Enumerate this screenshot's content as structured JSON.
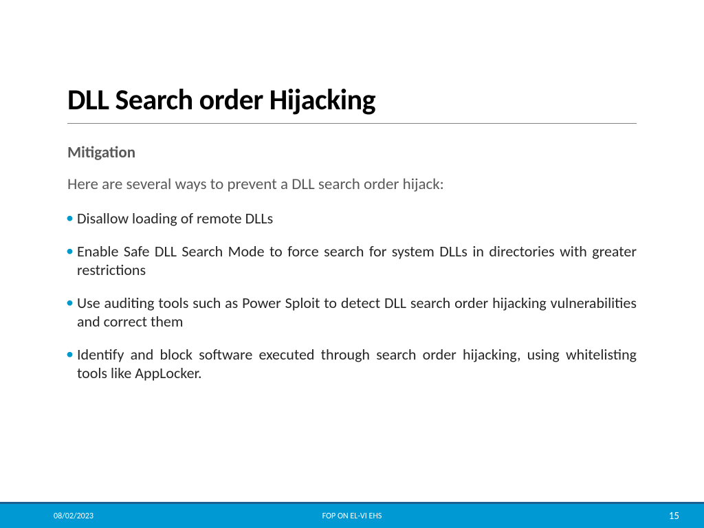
{
  "slide": {
    "title": "DLL Search order Hijacking",
    "section_heading": "Mitigation",
    "intro": "Here are several ways to prevent a DLL search order hijack:",
    "bullets": [
      "Disallow loading of remote DLLs",
      "Enable Safe DLL Search Mode to force search for system DLLs in directories with greater restrictions",
      "Use auditing tools such as Power Sploit to detect DLL search order hijacking vulnerabilities and correct them",
      "Identify and block software executed through search order hijacking, using whitelisting tools like AppLocker."
    ]
  },
  "footer": {
    "date": "08/02/2023",
    "center_text": "FOP ON EL-VI EHS",
    "page_number": "15"
  }
}
